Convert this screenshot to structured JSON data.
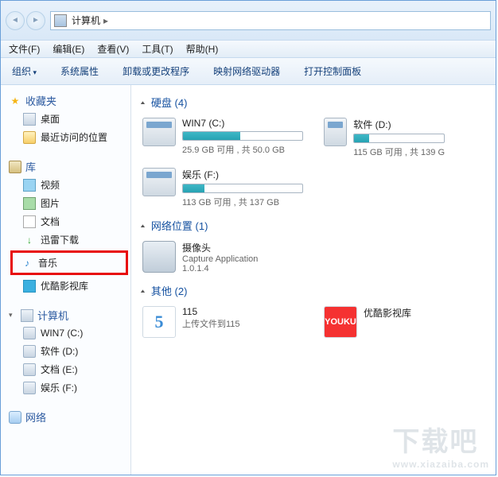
{
  "titlebar": {
    "path_root": "计算机",
    "separator": "▸"
  },
  "menu": {
    "file": "文件(F)",
    "edit": "编辑(E)",
    "view": "查看(V)",
    "tools": "工具(T)",
    "help": "帮助(H)"
  },
  "toolbar": {
    "organize": "组织",
    "sysprop": "系统属性",
    "uninstall": "卸载或更改程序",
    "mapdrive": "映射网络驱动器",
    "ctrlpanel": "打开控制面板"
  },
  "sidebar": {
    "favorites": {
      "label": "收藏夹",
      "items": [
        {
          "label": "桌面"
        },
        {
          "label": "最近访问的位置"
        }
      ]
    },
    "libraries": {
      "label": "库",
      "items": [
        {
          "label": "视频"
        },
        {
          "label": "图片"
        },
        {
          "label": "文档"
        },
        {
          "label": "迅雷下载"
        },
        {
          "label": "音乐",
          "highlight": true
        },
        {
          "label": "优酷影视库"
        }
      ]
    },
    "computer": {
      "label": "计算机",
      "items": [
        {
          "label": "WIN7 (C:)"
        },
        {
          "label": "软件 (D:)"
        },
        {
          "label": "文档 (E:)"
        },
        {
          "label": "娱乐 (F:)"
        }
      ]
    },
    "network": {
      "label": "网络"
    }
  },
  "content": {
    "disks": {
      "title": "硬盘 (4)",
      "items": [
        {
          "name": "WIN7 (C:)",
          "free": "25.9 GB 可用 , 共 50.0 GB",
          "pct": 48
        },
        {
          "name": "软件 (D:)",
          "free": "115 GB 可用 , 共 139 G",
          "pct": 17
        },
        {
          "name": "娱乐 (F:)",
          "free": "113 GB 可用 , 共 137 GB",
          "pct": 18
        }
      ]
    },
    "netloc": {
      "title": "网络位置 (1)",
      "items": [
        {
          "name": "摄像头",
          "sub1": "Capture Application",
          "sub2": "1.0.1.4"
        }
      ]
    },
    "other": {
      "title": "其他 (2)",
      "items": [
        {
          "name": "115",
          "sub": "上传文件到115",
          "icon": "5",
          "kind": "115"
        },
        {
          "name": "优酷影视库",
          "sub": "",
          "icon": "YOUKU",
          "kind": "youku"
        }
      ]
    }
  },
  "watermark": {
    "main": "下载吧",
    "sub": "www.xiazaiba.com"
  }
}
